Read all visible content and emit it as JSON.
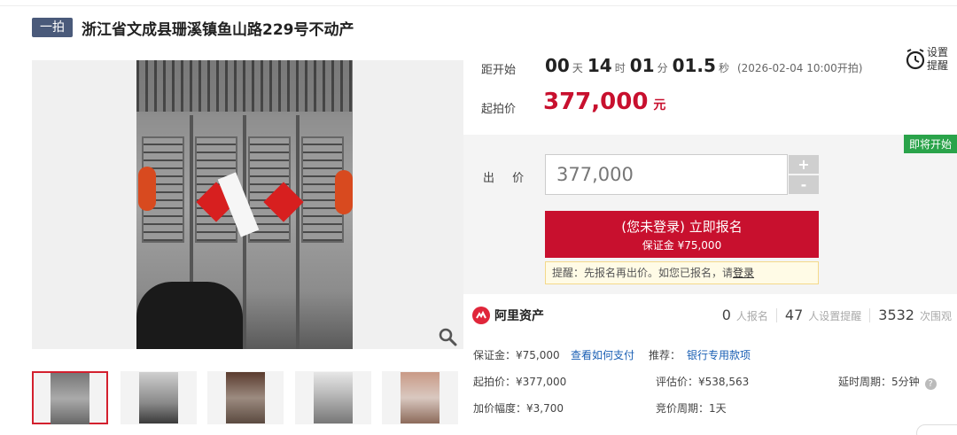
{
  "header": {
    "badge": "一拍",
    "title": "浙江省文成县珊溪镇鱼山路229号不动产"
  },
  "countdown": {
    "label": "距开始",
    "days": "00",
    "days_unit": "天",
    "hours": "14",
    "hours_unit": "时",
    "minutes": "01",
    "minutes_unit": "分",
    "seconds": "01.5",
    "seconds_unit": "秒",
    "start_text": "(2026-02-04 10:00开拍)"
  },
  "reminder": {
    "label": "设置提醒",
    "icon": "alarm-clock-icon"
  },
  "start_price": {
    "label": "起拍价",
    "value": "377,000",
    "unit": "元"
  },
  "bid": {
    "badge": "即将开始",
    "label": "出 价",
    "value": "377,000",
    "plus": "+",
    "minus": "-",
    "signup_main": "(您未登录) 立即报名",
    "signup_sub": "保证金 ¥75,000",
    "hint_text": "提醒：先报名再出价。如您已报名，请",
    "hint_link": "登录"
  },
  "brand": {
    "name": "阿里资产",
    "icon": "ali-asset-logo-icon"
  },
  "stats": {
    "signup_count": "0",
    "signup_unit": "人报名",
    "reminder_count": "47",
    "reminder_unit": "人设置提醒",
    "views_count": "3532",
    "views_unit": "次围观"
  },
  "details": {
    "deposit": "保证金：¥75,000",
    "how_to_pay": "查看如何支付",
    "recommend_label": "推荐：",
    "bank_link": "银行专用款项",
    "start_price": "起拍价：¥377,000",
    "appraisal": "评估价：¥538,563",
    "delay": "延时周期：5分钟",
    "increment": "加价幅度：¥3,700",
    "period": "竞价周期：1天"
  },
  "colors": {
    "accent_red": "#c8102e",
    "badge_green": "#2aa34a",
    "link_blue": "#1a5fb4"
  },
  "thumbnails": [
    {
      "name": "door-photo"
    },
    {
      "name": "hallway-photo"
    },
    {
      "name": "interior-room-photo"
    },
    {
      "name": "window-room-photo"
    },
    {
      "name": "bedroom-photo"
    }
  ]
}
